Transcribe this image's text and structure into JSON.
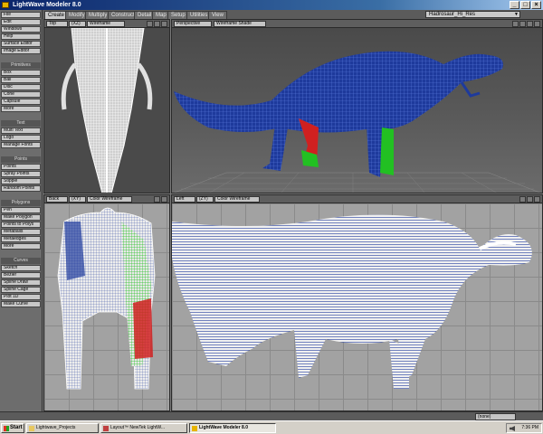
{
  "window": {
    "title": "LightWave Modeler 8.0",
    "btn_min": "_",
    "btn_max": "□",
    "btn_close": "×"
  },
  "menubar": {
    "file": "File",
    "tabs": [
      {
        "label": "Create",
        "active": true
      },
      {
        "label": "Modify"
      },
      {
        "label": "Multiply"
      },
      {
        "label": "Construct"
      },
      {
        "label": "Detail"
      },
      {
        "label": "Map"
      },
      {
        "label": "Setup"
      },
      {
        "label": "Utilities"
      },
      {
        "label": "View"
      }
    ],
    "object": "Hadrosaur_Hi_Res"
  },
  "sidebar": {
    "top": [
      "Edit",
      "Windows",
      "Help",
      "Surface Editor",
      "Image Editor"
    ],
    "groups": [
      {
        "header": "Primitives",
        "items": [
          "Box",
          "Ball",
          "Disc",
          "Cone",
          "Capsule",
          "More"
        ]
      },
      {
        "header": "Text",
        "items": [
          "Multi Text",
          "Logo",
          "Manage Fonts"
        ]
      },
      {
        "header": "Points",
        "items": [
          "Points",
          "Spray Points",
          "Stipple",
          "Random Points"
        ]
      },
      {
        "header": "Polygons",
        "items": [
          "Pen",
          "Make Polygon",
          "Points to Polys",
          "Metaballs",
          "Metaedges",
          "More"
        ]
      },
      {
        "header": "Curves",
        "items": [
          "Sketch",
          "Bezier",
          "Spline Draw",
          "Spline Cage",
          "Plot 1D",
          "Make Curve"
        ]
      }
    ]
  },
  "viewports": {
    "top_left": {
      "view": "Top",
      "axis": "(XZ)",
      "mode": "Wireframe"
    },
    "top_right": {
      "view": "Perspective",
      "mode": "Wireframe Shade"
    },
    "bottom_left": {
      "view": "Back",
      "axis": "(XY)",
      "mode": "Color Wireframe"
    },
    "bottom_right": {
      "view": "Left",
      "axis": "(ZY)",
      "mode": "Color Wireframe"
    }
  },
  "status": {
    "surface": "(none)"
  },
  "taskbar": {
    "start": "Start",
    "tasks": [
      {
        "label": "Lightwave_Projects"
      },
      {
        "label": "Layout™ NewTek LightW..."
      },
      {
        "label": "LightWave Modeler 8.0",
        "active": true
      }
    ],
    "clock": "7:36 PM"
  },
  "colors": {
    "mesh_blue": "#1e3a9c",
    "mesh_white": "#f2f2f2",
    "mesh_green": "#22c022",
    "mesh_red": "#d02020",
    "title_blue": "#0a246a"
  }
}
